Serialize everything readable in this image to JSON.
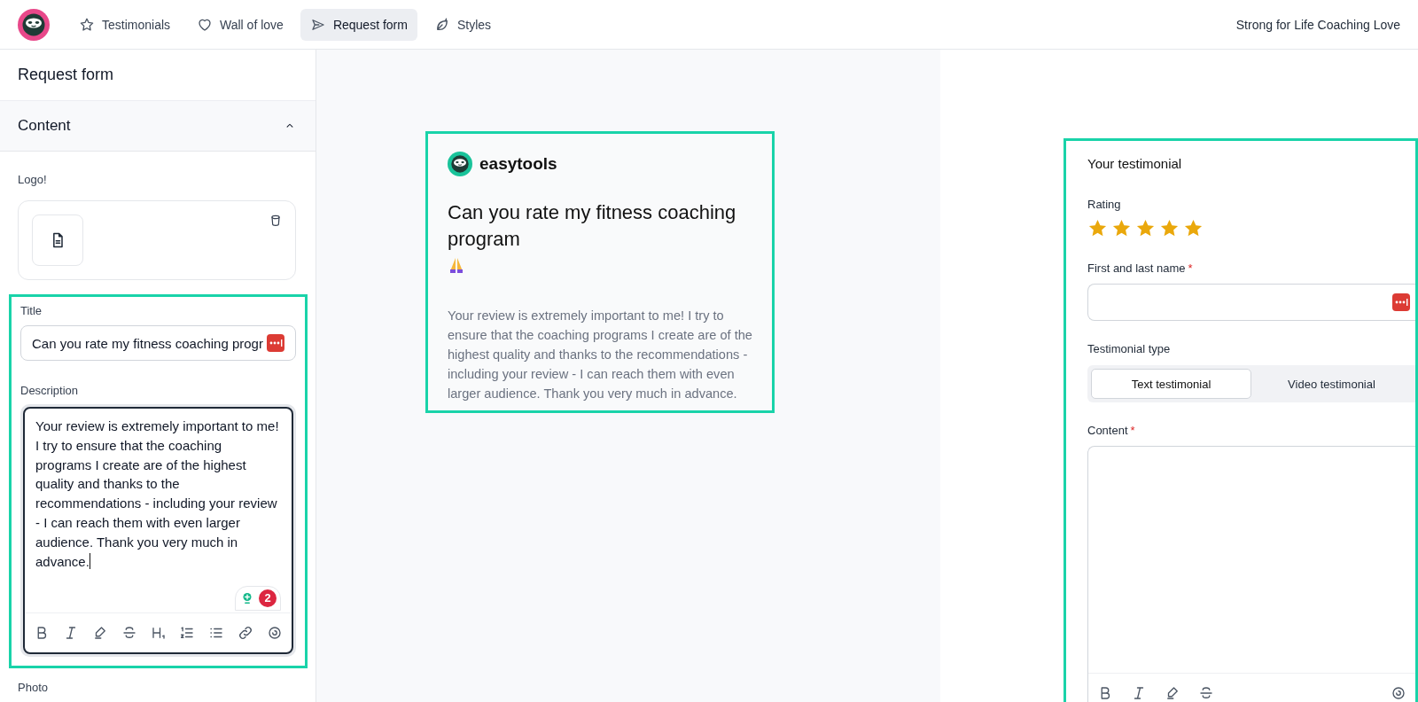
{
  "nav": {
    "tabs": [
      {
        "label": "Testimonials",
        "kind": "star",
        "selected": false
      },
      {
        "label": "Wall of love",
        "kind": "heart",
        "selected": false
      },
      {
        "label": "Request form",
        "kind": "send",
        "selected": true
      },
      {
        "label": "Styles",
        "kind": "leaf",
        "selected": false
      }
    ],
    "account": "Strong for Life Coaching Love"
  },
  "sidebar": {
    "title": "Request form",
    "section": {
      "label": "Content",
      "expanded": true
    },
    "logo_label": "Logo!",
    "title_label": "Title",
    "title_value": "Can you rate my fitness coaching progr",
    "description_label": "Description",
    "description_value": "Your review is extremely important to me! I try to ensure that the coaching programs I create are of the highest quality and thanks to the recommendations - including your review - I can reach them with even larger audience. Thank you very much in advance.",
    "grammar_count": "2",
    "next_label": "Photo"
  },
  "preview": {
    "brand": "easytools",
    "title": "Can you rate my fitness coaching program",
    "description": "Your review is extremely important to me! I try to ensure that the coaching programs I create are of the highest quality and thanks to the recommendations - including your review - I can reach them with even larger audience. Thank you very much in advance."
  },
  "form": {
    "heading": "Your testimonial",
    "rating_label": "Rating",
    "stars": 5,
    "name_label": "First and last name",
    "name_mark": "*",
    "type_label": "Testimonial type",
    "types": [
      {
        "label": "Text testimonial",
        "selected": true
      },
      {
        "label": "Video testimonial",
        "selected": false
      }
    ],
    "content_label": "Content",
    "content_mark": "*"
  }
}
